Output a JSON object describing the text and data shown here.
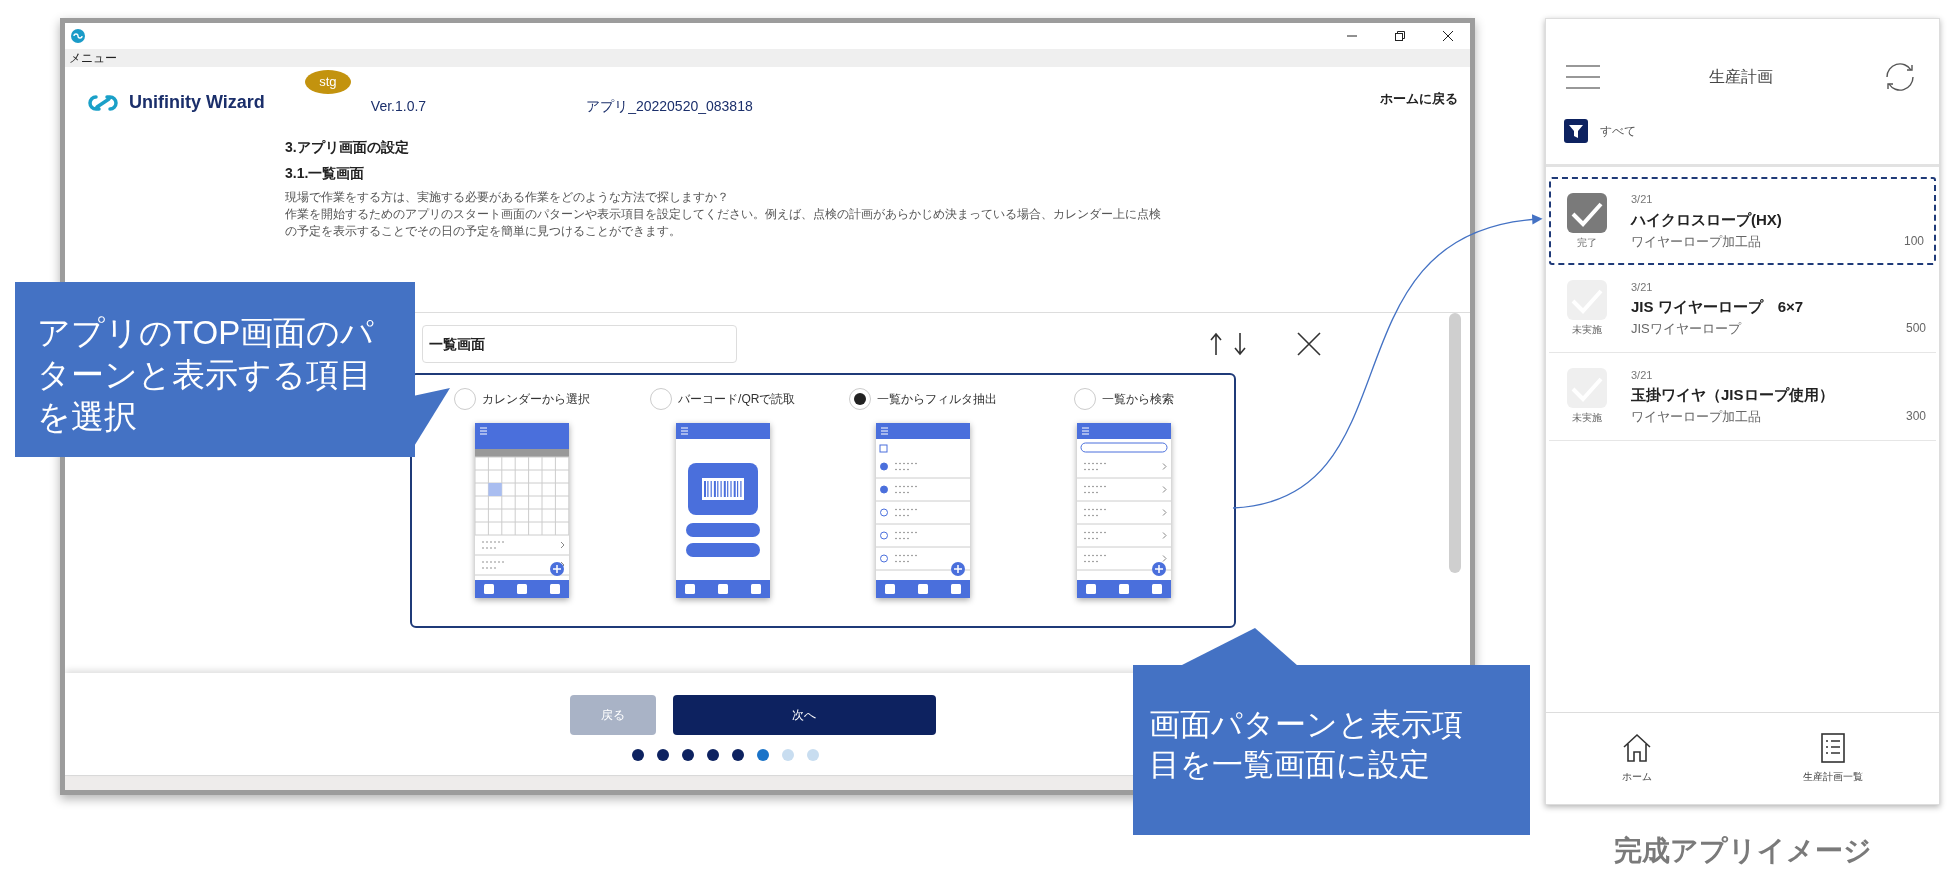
{
  "window": {
    "menu": "メニュー"
  },
  "header": {
    "logo_text": "Unifinity Wizard",
    "env_badge": "stg",
    "version": "Ver.1.0.7",
    "app_name": "アプリ_20220520_083818",
    "home_link": "ホームに戻る"
  },
  "section": {
    "title": "3.アプリ画面の設定",
    "subtitle": "3.1.一覧画面",
    "description": [
      "現場で作業をする方は、実施する必要がある作業をどのような方法で探しますか？",
      "作業を開始するためのアプリのスタート画面のパターンや表示項目を設定してください。例えば、点検の計画があらかじめ決まっている場合、カレンダー上に点検の予定を表示することでその日の予定を簡単に見つけることができます。"
    ]
  },
  "screen_name_field": {
    "value": "一覧画面"
  },
  "patterns": [
    {
      "label": "カレンダーから選択",
      "kind": "calendar",
      "selected": false
    },
    {
      "label": "バーコード/QRで読取",
      "kind": "barcode",
      "selected": false
    },
    {
      "label": "一覧からフィルタ抽出",
      "kind": "filter",
      "selected": true
    },
    {
      "label": "一覧から検索",
      "kind": "search",
      "selected": false
    }
  ],
  "footer": {
    "back_button": {
      "label": "戻る",
      "disabled": true
    },
    "next_button": "次へ",
    "steps": [
      {
        "done": true,
        "current": false
      },
      {
        "done": true,
        "current": false
      },
      {
        "done": true,
        "current": false
      },
      {
        "done": true,
        "current": false
      },
      {
        "done": true,
        "current": false
      },
      {
        "done": false,
        "current": true
      },
      {
        "done": false,
        "current": false
      },
      {
        "done": false,
        "current": false
      }
    ]
  },
  "callouts": [
    {
      "text": "アプリのTOP画面のパターンと表示する項目を選択"
    },
    {
      "text": "画面パターンと表示項目を一覧画面に設定"
    }
  ],
  "phone": {
    "title": "生産計画",
    "filter": "すべて",
    "items": [
      {
        "date": "3/21",
        "name": "ハイクロスロープ(HX)",
        "category": "ワイヤーロープ加工品",
        "quantity": "100",
        "status_label": "完了",
        "done": true,
        "highlighted": true
      },
      {
        "date": "3/21",
        "name": "JIS ワイヤーロープ　6×7",
        "category": "JISワイヤーロープ",
        "quantity": "500",
        "status_label": "未実施",
        "done": false,
        "highlighted": false
      },
      {
        "date": "3/21",
        "name": "玉掛ワイヤ（JISロープ使用）",
        "category": "ワイヤーロープ加工品",
        "quantity": "300",
        "status_label": "未実施",
        "done": false,
        "highlighted": false
      }
    ],
    "nav": [
      {
        "label": "ホーム",
        "kind": "home"
      },
      {
        "label": "生産計画一覧",
        "kind": "list"
      }
    ]
  },
  "caption": "完成アプリイメージ"
}
